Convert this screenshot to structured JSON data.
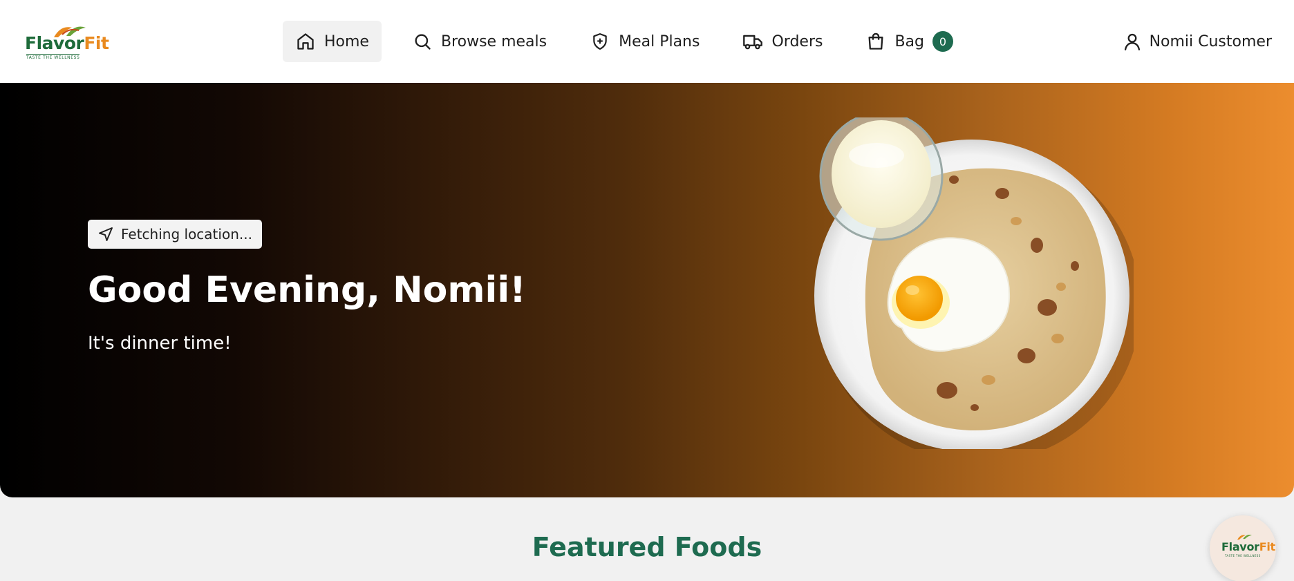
{
  "brand": {
    "name_part1": "Flavor",
    "name_part2": "Fit",
    "tagline": "TASTE THE WELLNESS",
    "colors": {
      "green": "#1e6b3a",
      "orange": "#e98a1f",
      "accent": "#1e6b50"
    }
  },
  "nav": {
    "items": [
      {
        "label": "Home",
        "icon": "home-icon",
        "active": true
      },
      {
        "label": "Browse meals",
        "icon": "search-icon",
        "active": false
      },
      {
        "label": "Meal Plans",
        "icon": "shield-plus-icon",
        "active": false
      },
      {
        "label": "Orders",
        "icon": "truck-icon",
        "active": false
      },
      {
        "label": "Bag",
        "icon": "shopping-bag-icon",
        "active": false,
        "badge": "0"
      }
    ],
    "user": {
      "label": "Nomii Customer",
      "icon": "user-icon"
    }
  },
  "hero": {
    "location_status": "Fetching location...",
    "location_icon": "navigation-arrow-icon",
    "greeting": "Good Evening, Nomii!",
    "subtitle": "It's dinner time!",
    "image": "plate-with-paratha-fried-egg-and-milk"
  },
  "featured": {
    "title": "Featured Foods"
  },
  "floating_button": {
    "name_part1": "Flavor",
    "name_part2": "Fit",
    "tagline": "TASTE THE WELLNESS"
  }
}
